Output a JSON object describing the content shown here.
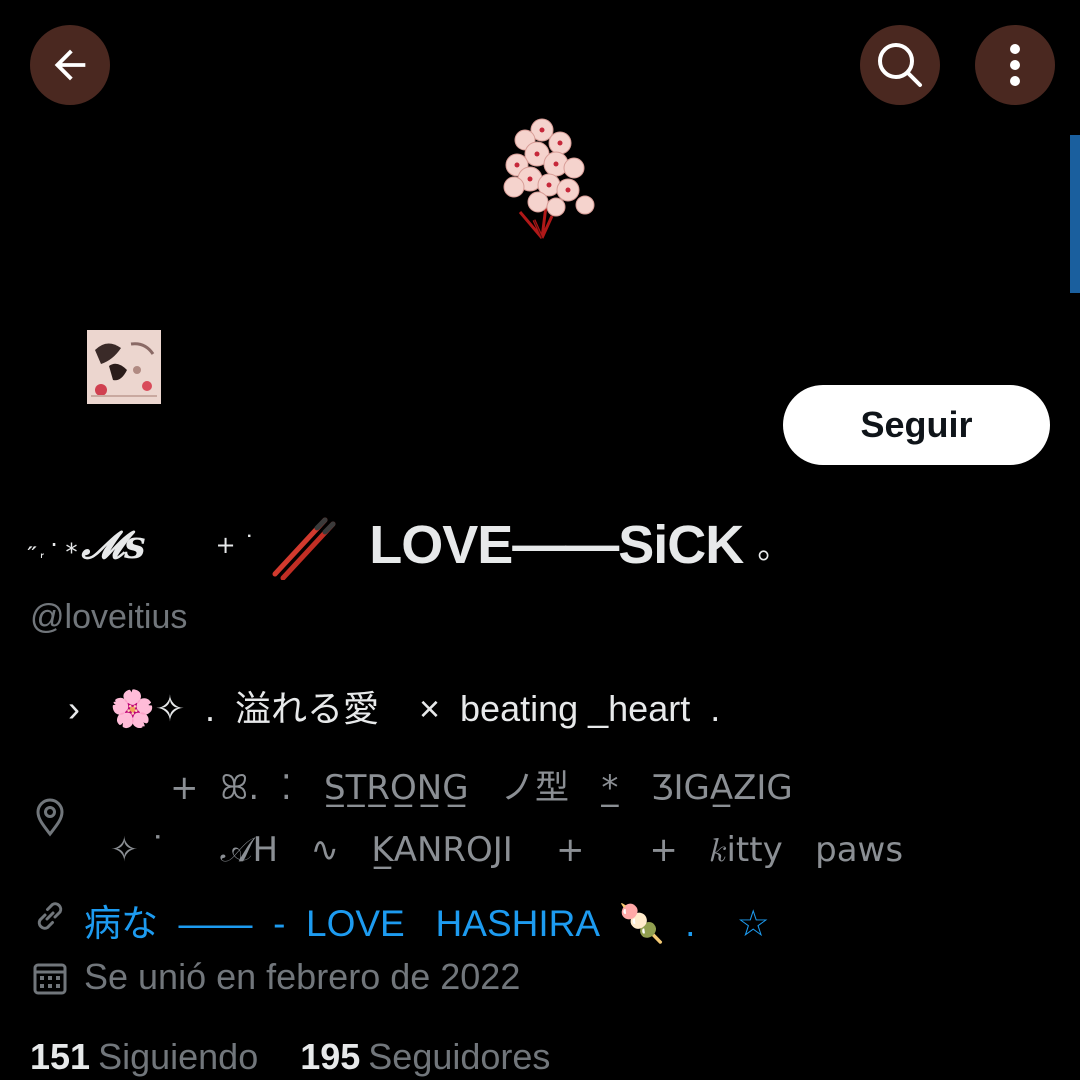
{
  "header": {
    "back_icon": "arrow-left-icon",
    "search_icon": "search-icon",
    "more_icon": "more-vertical-icon",
    "button_bg": "#4a2820"
  },
  "banner": {
    "image": "cherry-blossom-branch"
  },
  "avatar": {
    "image": "profile-picture-pink"
  },
  "follow_button": {
    "label": "Seguir"
  },
  "profile": {
    "display_name_deco": "˶ ᷊ ·  ⁎",
    "display_name_ms": "𝓜s",
    "display_name_deco2": "+ ˙",
    "display_name_main": "LOVE——SiCK",
    "display_name_end": "。",
    "handle": "@loveitius"
  },
  "bio": {
    "line1": "›   🌸✧  .  溢れる愛    ×  beating _heart  .",
    "location_line1": "+  ꕤ.  ⁚   S̲T̲R̲O̲N̲G̲   ノ型   *̲   ƷIGA̲ZIG",
    "location_line2": "✧ ˙     𝒜H   ∿   K̲ANROJI    +      +   𝑘itty   paws",
    "link": "病な  ——  -  LOVE   HASHIRA  🍡  .    ☆",
    "joined": "Se unió en febrero de 2022"
  },
  "stats": {
    "following_count": "151",
    "following_label": "Siguiendo",
    "followers_count": "195",
    "followers_label": "Seguidores"
  },
  "colors": {
    "background": "#000000",
    "link": "#1d9bf0",
    "muted": "#71767b"
  }
}
